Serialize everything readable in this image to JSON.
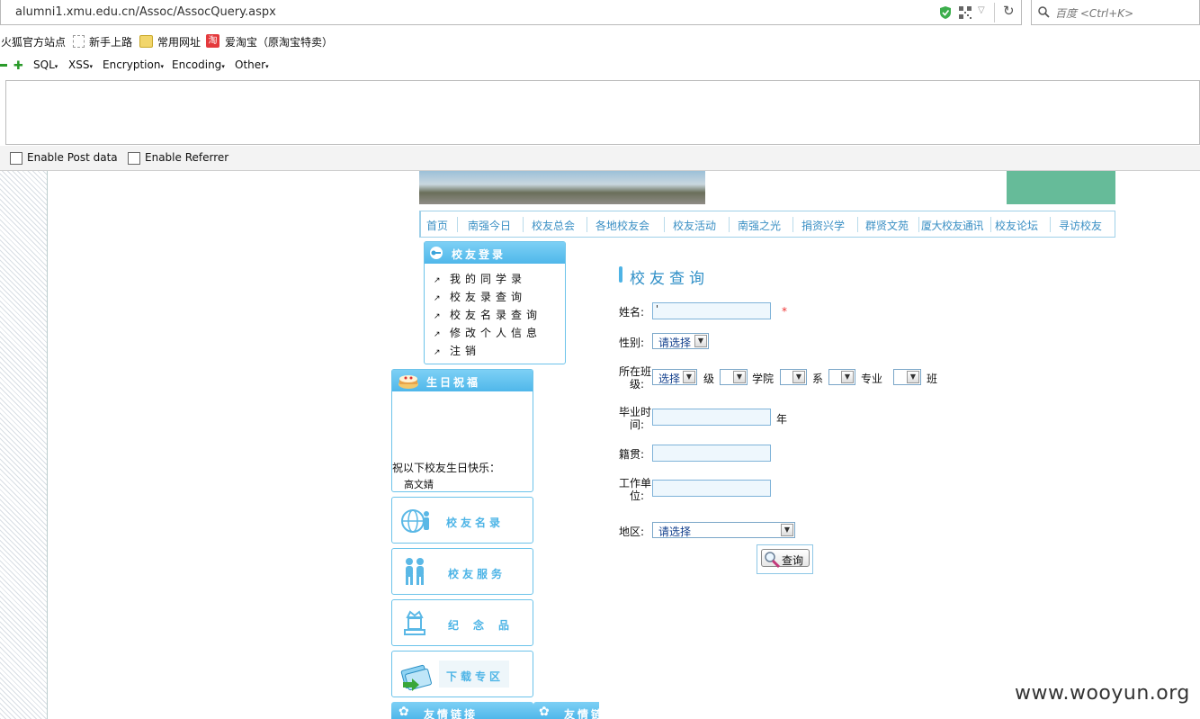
{
  "browser": {
    "url": "alumni1.xmu.edu.cn/Assoc/AssocQuery.aspx",
    "url_host": "alumni1.xmu.edu.cn",
    "url_path": "/Assoc/AssocQuery.aspx",
    "search_placeholder": "百度 <Ctrl+K>",
    "bookmarks": [
      "火狐官方站点",
      "新手上路",
      "常用网址",
      "爱淘宝（原淘宝特卖）"
    ],
    "toolbar_menus": [
      "SQL",
      "XSS",
      "Encryption",
      "Encoding",
      "Other"
    ],
    "enable_post": "Enable Post data",
    "enable_referrer": "Enable Referrer"
  },
  "nav": [
    "首页",
    "南强今日",
    "校友总会",
    "各地校友会",
    "校友活动",
    "南强之光",
    "捐资兴学",
    "群贤文苑",
    "厦大校友通讯",
    "校友论坛",
    "寻访校友"
  ],
  "login_box": {
    "title": "校友登录",
    "items": [
      "我的同学录",
      "校友录查询",
      "校友名录查询",
      "修改个人信息",
      "注销"
    ]
  },
  "birthday": {
    "title": "生日祝福",
    "message": "祝以下校友生日快乐：",
    "name": "高文婧"
  },
  "side_buttons": [
    "校友名录",
    "校友服务",
    "纪念品",
    "下载专区"
  ],
  "friend_links": [
    "友情链接",
    "友情链"
  ],
  "form": {
    "title": "校友查询",
    "name_label": "姓名:",
    "name_value": "'",
    "required_mark": "*",
    "gender_label": "性别:",
    "gender_value": "请选择",
    "class_label_1": "所在班",
    "class_label_2": "级:",
    "select_label": "选择",
    "grade_unit": "级",
    "college_unit": "学院",
    "dept_unit": "系",
    "major_unit": "专业",
    "class_unit": "班",
    "grad_label_1": "毕业时",
    "grad_label_2": "间:",
    "year_unit": "年",
    "origin_label": "籍贯:",
    "work_label_1": "工作单",
    "work_label_2": "位:",
    "region_label": "地区:",
    "region_value": "请选择",
    "query_button": "查询"
  },
  "watermark": "www.wooyun.org"
}
